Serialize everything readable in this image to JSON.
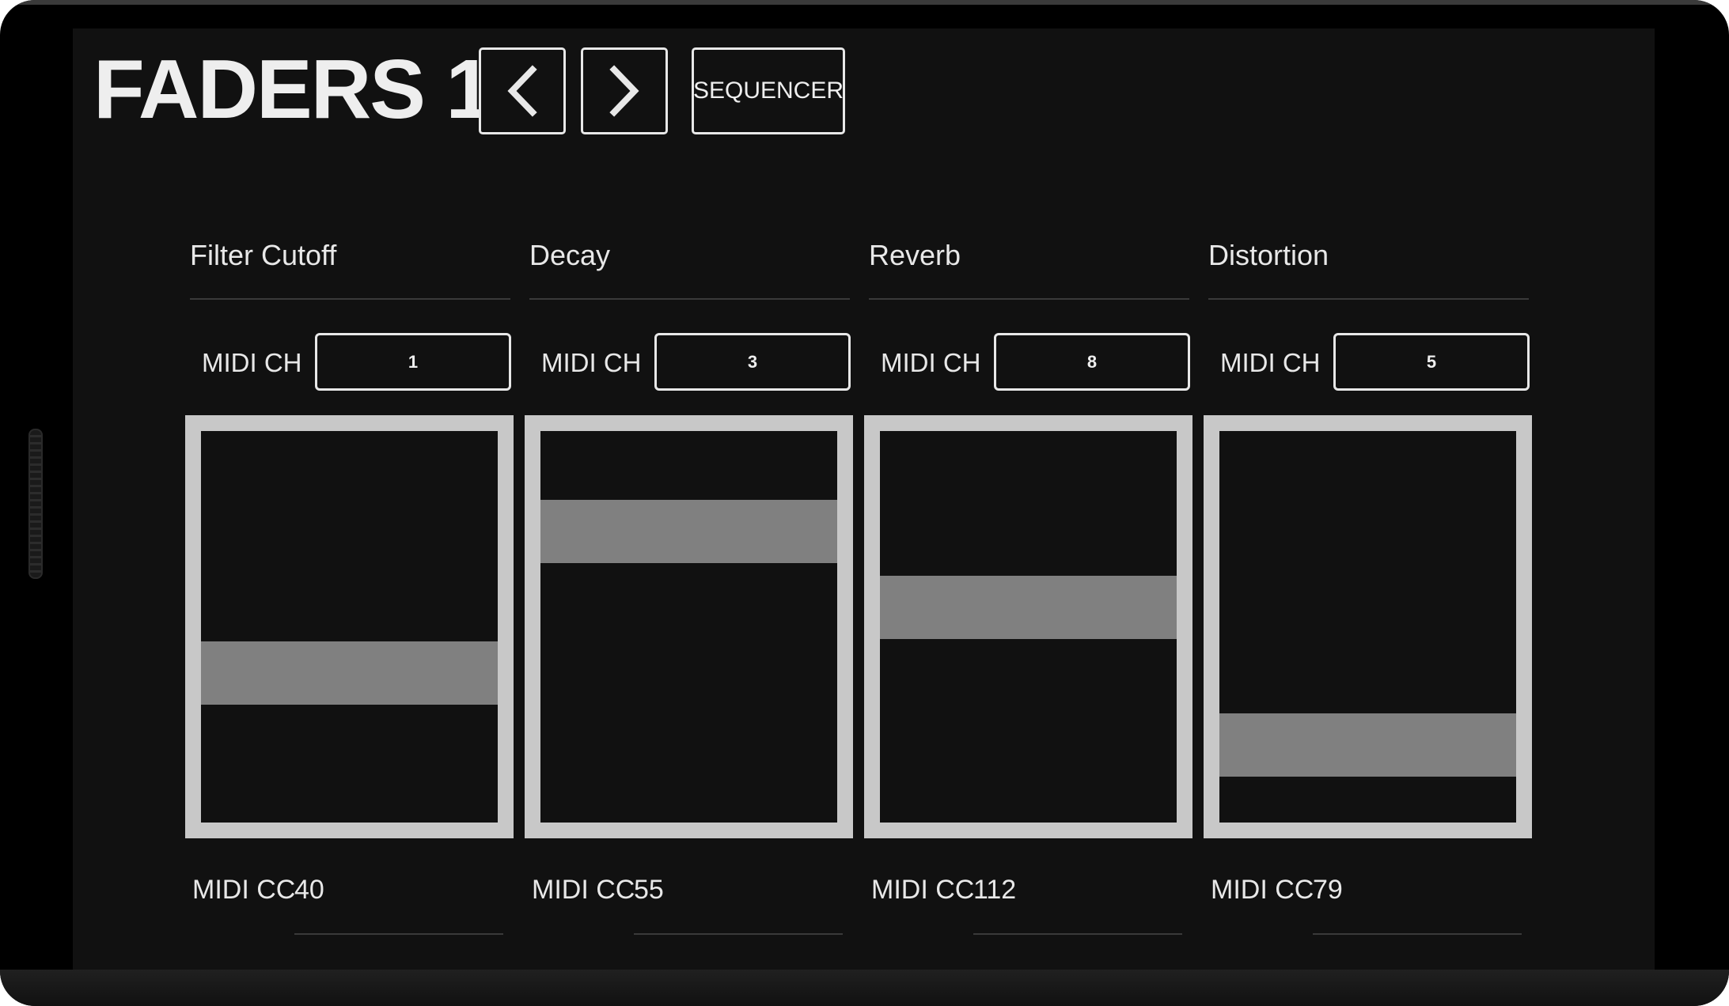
{
  "header": {
    "title": "FADERS 1",
    "prev_icon": "chevron-left-icon",
    "next_icon": "chevron-right-icon",
    "sequencer_label": "SEQUENCER"
  },
  "faders": [
    {
      "label": "Filter Cutoff",
      "midi_ch_label": "MIDI CH",
      "midi_ch": "1",
      "cc_label": "MIDI CC",
      "cc": "40",
      "level": 0.36
    },
    {
      "label": "Decay",
      "midi_ch_label": "MIDI CH",
      "midi_ch": "3",
      "cc_label": "MIDI CC",
      "cc": "55",
      "level": 0.79
    },
    {
      "label": "Reverb",
      "midi_ch_label": "MIDI CH",
      "midi_ch": "8",
      "cc_label": "MIDI CC",
      "cc": "112",
      "level": 0.56
    },
    {
      "label": "Distortion",
      "midi_ch_label": "MIDI CH",
      "midi_ch": "5",
      "cc_label": "MIDI CC",
      "cc": "79",
      "level": 0.14
    }
  ],
  "colors": {
    "background": "#111111",
    "foreground": "#e8e8e8",
    "fader_frame": "#c8c8c8",
    "fader_handle": "#808080"
  }
}
